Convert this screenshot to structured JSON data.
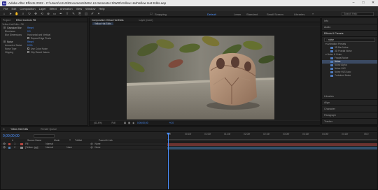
{
  "window": {
    "title": "Adobe After Effects 2022 - C:\\Users\\ASUS\\Documents\\MSA L5 Semester 5\\W05\\Yellow Hat\\Yellow Hat Edits.aep",
    "app_badge": "Ae",
    "minimize": "–",
    "maximize": "□",
    "close": "✕"
  },
  "menu": [
    "File",
    "Edit",
    "Composition",
    "Layer",
    "Effect",
    "Animation",
    "View",
    "Window",
    "Help"
  ],
  "toolbar": {
    "snapping": "Snapping",
    "workspaces": [
      "Default",
      "Learn",
      "Standard",
      "Small Screen",
      "Libraries"
    ],
    "active_workspace": "Default",
    "search_placeholder": "Search Help"
  },
  "left_panel": {
    "tabs": [
      "Project",
      "Effect Controls Fill"
    ],
    "breadcrumb": "Yellow Hat Edits • Fill",
    "effects": [
      {
        "name": "Gaussian Blur",
        "reset": "Reset",
        "props": [
          {
            "label": "Blurriness",
            "value": "0.0"
          },
          {
            "label": "Blur Dimensions",
            "value": "Horizontal and Vertical"
          },
          {
            "label": "",
            "value": "Repeat Edge Pixels",
            "checkbox": true
          }
        ]
      },
      {
        "name": "Noise",
        "reset": "Reset",
        "props": [
          {
            "label": "Amount of Noise",
            "value": "0.0%"
          },
          {
            "label": "Noise Type",
            "value": "Use Color Noise",
            "checkbox": true
          },
          {
            "label": "Clipping",
            "value": "Clip Result Values",
            "checkbox": true
          }
        ]
      }
    ]
  },
  "comp_panel": {
    "tabs": [
      "Composition Yellow Hat Edits",
      "Layer (none)"
    ],
    "sub_tab": "Yellow Hat Edits",
    "zoom": "(41.4%)",
    "resolution": "Full",
    "timecode": "0;00;00;00",
    "exposure": "+0.0"
  },
  "right_panel": {
    "sections_top": [
      "Info",
      "Audio"
    ],
    "fx_header": "Effects & Presets",
    "fx_search": "noise",
    "fx_tree": [
      {
        "type": "cat",
        "label": "▾ Animation Presets"
      },
      {
        "type": "itm",
        "label": "3D Bar Noise"
      },
      {
        "type": "itm",
        "label": "3D Fractal Noise"
      },
      {
        "type": "cat",
        "label": "▾ Noise & Grain"
      },
      {
        "type": "itm",
        "label": "Fractal Noise"
      },
      {
        "type": "itm",
        "label": "Noise",
        "selected": true
      },
      {
        "type": "itm",
        "label": "Noise Alpha"
      },
      {
        "type": "itm",
        "label": "Noise HLS"
      },
      {
        "type": "itm",
        "label": "Noise HLS Auto"
      },
      {
        "type": "itm",
        "label": "Turbulent Noise"
      }
    ],
    "sections_bottom": [
      "Libraries",
      "Align",
      "Character",
      "Paragraph",
      "Tracker"
    ]
  },
  "timeline": {
    "tabs": [
      "Yellow Hat Edits",
      "Render Queue"
    ],
    "timecode": "0;00;00;00",
    "columns": [
      "#",
      "Source Name",
      "Mode",
      "T",
      "TrkMat",
      "Parent & Link"
    ],
    "layers": [
      {
        "index": "1",
        "name": "Fill",
        "mode": "Normal",
        "trkmat": "",
        "parent": "None",
        "color": "#b7463f"
      },
      {
        "index": "2",
        "name": "[Yellow...jpg]",
        "mode": "Normal",
        "trkmat": "None",
        "parent": "None",
        "color": "#4e7fb0"
      }
    ],
    "ruler": [
      "0f",
      "00:15f",
      "01:00f",
      "01:15f",
      "02:00f",
      "02:15f",
      "03:00f",
      "03:15f",
      "04:00f",
      "04:15f",
      "05:0"
    ]
  },
  "colors": {
    "accent": "#4a90ff",
    "selection": "#3b4a63",
    "panel": "#232323"
  }
}
